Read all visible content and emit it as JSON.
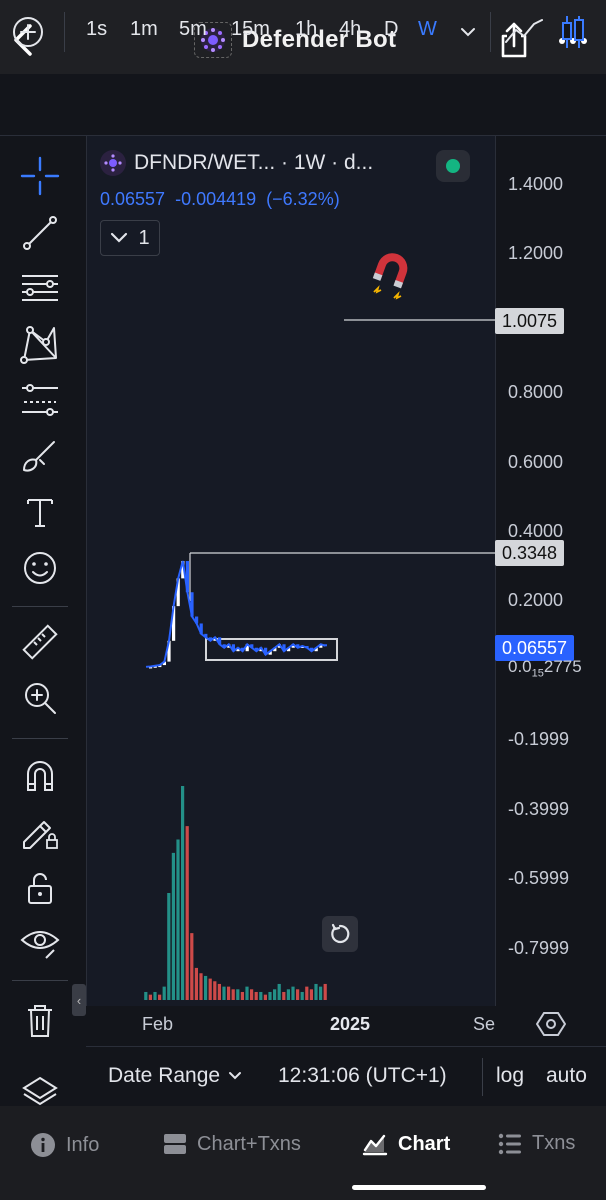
{
  "header": {
    "title": "Defender Bot"
  },
  "toolbar": {
    "timeframes": [
      "1s",
      "1m",
      "5m",
      "15m",
      "1h",
      "4h",
      "D",
      "W"
    ],
    "active_timeframe": "W"
  },
  "chart": {
    "symbol": "DFNDR/WET... · 1W · d...",
    "ohlc": {
      "last": "0.06557",
      "change": "-0.004419",
      "change_pct": "(−6.32%)"
    },
    "study_toggle_count": "1",
    "price_axis": [
      "1.4000",
      "1.2000",
      "0.8000",
      "0.6000",
      "0.4000",
      "0.2000",
      "-0.1999",
      "-0.3999",
      "-0.5999",
      "-0.7999"
    ],
    "badges": {
      "line_high": "1.0075",
      "line_low": "0.3348",
      "last_price": "0.06557"
    },
    "sub_price": {
      "prefix": "0.0",
      "zeros": "15",
      "suffix": "2775"
    },
    "time_axis": [
      "Feb",
      "2025",
      "Se"
    ]
  },
  "chart_data": {
    "type": "bar",
    "title": "",
    "price_series": {
      "name": "",
      "type": "line",
      "values": [
        0.005,
        0.006,
        0.008,
        0.01,
        0.02,
        0.08,
        0.18,
        0.26,
        0.31,
        0.22,
        0.15,
        0.13,
        0.1,
        0.09,
        0.08,
        0.09,
        0.07,
        0.06,
        0.07,
        0.05,
        0.06,
        0.05,
        0.07,
        0.06,
        0.05,
        0.06,
        0.04,
        0.05,
        0.06,
        0.07,
        0.05,
        0.06,
        0.07,
        0.06,
        0.065,
        0.06,
        0.05,
        0.06,
        0.07,
        0.06557
      ]
    },
    "volume_series": {
      "name": "",
      "values": [
        3,
        2,
        3,
        2,
        5,
        40,
        55,
        60,
        80,
        65,
        25,
        12,
        10,
        9,
        8,
        7,
        6,
        5,
        5,
        4,
        4,
        3,
        5,
        4,
        3,
        3,
        2,
        3,
        4,
        6,
        3,
        4,
        5,
        4,
        3,
        5,
        4,
        6,
        5,
        6
      ],
      "up": [
        true,
        false,
        true,
        false,
        true,
        true,
        true,
        true,
        true,
        false,
        false,
        false,
        false,
        true,
        false,
        false,
        false,
        true,
        false,
        false,
        true,
        false,
        true,
        false,
        false,
        true,
        false,
        true,
        true,
        true,
        false,
        true,
        true,
        false,
        true,
        false,
        false,
        true,
        true,
        false
      ]
    },
    "ylim": [
      -0.85,
      1.45
    ],
    "colors": {
      "up": "#26a69a",
      "down": "#ef5350",
      "line": "#2962ff",
      "annotation": "#d4d6da"
    }
  },
  "datebar": {
    "date_range": "Date Range",
    "clock": "12:31:06 (UTC+1)",
    "log": "log",
    "auto": "auto"
  },
  "tabs": [
    {
      "label": "Info",
      "icon": "info-icon"
    },
    {
      "label": "Chart+Txns",
      "icon": "split-icon"
    },
    {
      "label": "Chart",
      "icon": "chart-icon"
    },
    {
      "label": "Txns",
      "icon": "list-icon"
    }
  ],
  "active_tab": "Chart"
}
